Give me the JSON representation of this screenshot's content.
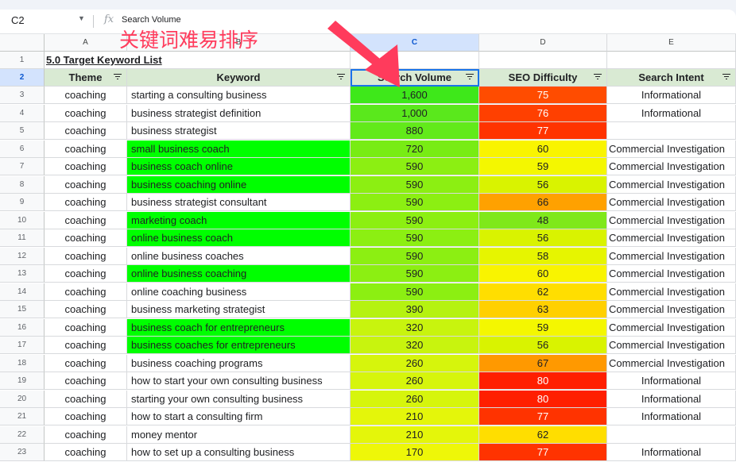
{
  "formula_bar": {
    "cell_ref": "C2",
    "fx_symbol": "fx",
    "value": "Search Volume"
  },
  "annotation": {
    "text": "关键词难易排序",
    "color": "#ff3b5c"
  },
  "columns": [
    "A",
    "B",
    "C",
    "D",
    "E"
  ],
  "title_row": {
    "row_number": "1",
    "text": "5.0 Target Keyword List"
  },
  "header_row": {
    "row_number": "2",
    "headers": [
      "Theme",
      "Keyword",
      "Search Volume",
      "SEO Difficulty",
      "Search Intent"
    ]
  },
  "rows": [
    {
      "n": "3",
      "theme": "coaching",
      "keyword": "starting a consulting business",
      "volume": "1,600",
      "difficulty": "75",
      "intent": "Informational",
      "kw_green": false,
      "vol_color": "#3ee81a",
      "diff_color": "#ff4c00",
      "intent_center": true
    },
    {
      "n": "4",
      "theme": "coaching",
      "keyword": "business strategist definition",
      "volume": "1,000",
      "difficulty": "76",
      "intent": "Informational",
      "kw_green": false,
      "vol_color": "#5ae81c",
      "diff_color": "#ff4000",
      "intent_center": true
    },
    {
      "n": "5",
      "theme": "coaching",
      "keyword": "business strategist",
      "volume": "880",
      "difficulty": "77",
      "intent": "",
      "kw_green": false,
      "vol_color": "#62ea1a",
      "diff_color": "#ff3300",
      "intent_center": true
    },
    {
      "n": "6",
      "theme": "coaching",
      "keyword": "small business coach",
      "volume": "720",
      "difficulty": "60",
      "intent": "Commercial Investigation",
      "kw_green": true,
      "vol_color": "#78ec14",
      "diff_color": "#f9f400",
      "intent_center": false
    },
    {
      "n": "7",
      "theme": "coaching",
      "keyword": "business coach online",
      "volume": "590",
      "difficulty": "59",
      "intent": "Commercial Investigation",
      "kw_green": true,
      "vol_color": "#8cef12",
      "diff_color": "#f4f700",
      "intent_center": false
    },
    {
      "n": "8",
      "theme": "coaching",
      "keyword": "business coaching online",
      "volume": "590",
      "difficulty": "56",
      "intent": "Commercial Investigation",
      "kw_green": true,
      "vol_color": "#8cef12",
      "diff_color": "#d9f300",
      "intent_center": false
    },
    {
      "n": "9",
      "theme": "coaching",
      "keyword": "business strategist consultant",
      "volume": "590",
      "difficulty": "66",
      "intent": "Commercial Investigation",
      "kw_green": false,
      "vol_color": "#8cef12",
      "diff_color": "#ffa100",
      "intent_center": false
    },
    {
      "n": "10",
      "theme": "coaching",
      "keyword": "marketing coach",
      "volume": "590",
      "difficulty": "48",
      "intent": "Commercial Investigation",
      "kw_green": true,
      "vol_color": "#8cef12",
      "diff_color": "#7fe81a",
      "intent_center": false
    },
    {
      "n": "11",
      "theme": "coaching",
      "keyword": "online business coach",
      "volume": "590",
      "difficulty": "56",
      "intent": "Commercial Investigation",
      "kw_green": true,
      "vol_color": "#8cef12",
      "diff_color": "#d9f300",
      "intent_center": false
    },
    {
      "n": "12",
      "theme": "coaching",
      "keyword": "online business coaches",
      "volume": "590",
      "difficulty": "58",
      "intent": "Commercial Investigation",
      "kw_green": false,
      "vol_color": "#8cef12",
      "diff_color": "#e6f500",
      "intent_center": false
    },
    {
      "n": "13",
      "theme": "coaching",
      "keyword": "online business coaching",
      "volume": "590",
      "difficulty": "60",
      "intent": "Commercial Investigation",
      "kw_green": true,
      "vol_color": "#8cef12",
      "diff_color": "#f9f400",
      "intent_center": false
    },
    {
      "n": "14",
      "theme": "coaching",
      "keyword": "online coaching business",
      "volume": "590",
      "difficulty": "62",
      "intent": "Commercial Investigation",
      "kw_green": false,
      "vol_color": "#8cef12",
      "diff_color": "#ffde00",
      "intent_center": false
    },
    {
      "n": "15",
      "theme": "coaching",
      "keyword": "business marketing strategist",
      "volume": "390",
      "difficulty": "63",
      "intent": "Commercial Investigation",
      "kw_green": false,
      "vol_color": "#b5f210",
      "diff_color": "#ffd000",
      "intent_center": false
    },
    {
      "n": "16",
      "theme": "coaching",
      "keyword": "business coach for entrepreneurs",
      "volume": "320",
      "difficulty": "59",
      "intent": "Commercial Investigation",
      "kw_green": true,
      "vol_color": "#c8f40e",
      "diff_color": "#f4f700",
      "intent_center": false
    },
    {
      "n": "17",
      "theme": "coaching",
      "keyword": "business coaches for entrepreneurs",
      "volume": "320",
      "difficulty": "56",
      "intent": "Commercial Investigation",
      "kw_green": true,
      "vol_color": "#c8f40e",
      "diff_color": "#d9f300",
      "intent_center": false
    },
    {
      "n": "18",
      "theme": "coaching",
      "keyword": "business coaching programs",
      "volume": "260",
      "difficulty": "67",
      "intent": "Commercial Investigation",
      "kw_green": false,
      "vol_color": "#d6f50c",
      "diff_color": "#ff9900",
      "intent_center": false
    },
    {
      "n": "19",
      "theme": "coaching",
      "keyword": "how to start your own consulting business",
      "volume": "260",
      "difficulty": "80",
      "intent": "Informational",
      "kw_green": false,
      "vol_color": "#d6f50c",
      "diff_color": "#ff1f00",
      "intent_center": true
    },
    {
      "n": "20",
      "theme": "coaching",
      "keyword": "starting your own consulting business",
      "volume": "260",
      "difficulty": "80",
      "intent": "Informational",
      "kw_green": false,
      "vol_color": "#d6f50c",
      "diff_color": "#ff1f00",
      "intent_center": true
    },
    {
      "n": "21",
      "theme": "coaching",
      "keyword": "how to start a consulting firm",
      "volume": "210",
      "difficulty": "77",
      "intent": "Informational",
      "kw_green": false,
      "vol_color": "#e4f60a",
      "diff_color": "#ff3300",
      "intent_center": true
    },
    {
      "n": "22",
      "theme": "coaching",
      "keyword": "money mentor",
      "volume": "210",
      "difficulty": "62",
      "intent": "",
      "kw_green": false,
      "vol_color": "#e4f60a",
      "diff_color": "#ffde00",
      "intent_center": true
    },
    {
      "n": "23",
      "theme": "coaching",
      "keyword": "how to set up a consulting business",
      "volume": "170",
      "difficulty": "77",
      "intent": "Informational",
      "kw_green": false,
      "vol_color": "#eef708",
      "diff_color": "#ff3300",
      "intent_center": true
    }
  ]
}
